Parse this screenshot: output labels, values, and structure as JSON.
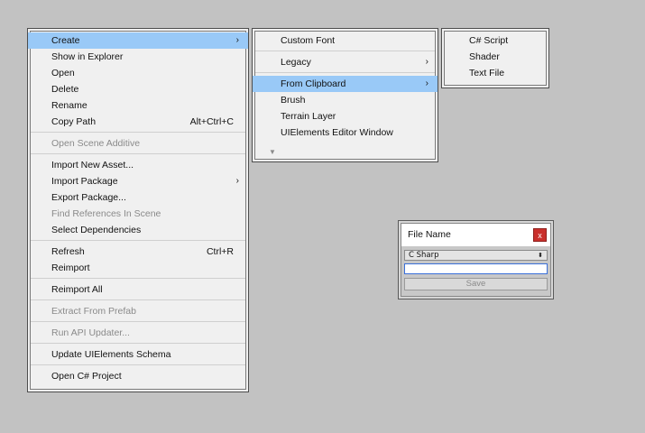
{
  "main_menu": {
    "items": [
      {
        "label": "Create",
        "arrow": "›"
      },
      {
        "label": "Show in Explorer"
      },
      {
        "label": "Open"
      },
      {
        "label": "Delete"
      },
      {
        "label": "Rename"
      },
      {
        "label": "Copy Path",
        "shortcut": "Alt+Ctrl+C"
      },
      {
        "label": "Open Scene Additive"
      },
      {
        "label": "Import New Asset..."
      },
      {
        "label": "Import Package",
        "arrow": "›"
      },
      {
        "label": "Export Package..."
      },
      {
        "label": "Find References In Scene"
      },
      {
        "label": "Select Dependencies"
      },
      {
        "label": "Refresh",
        "shortcut": "Ctrl+R"
      },
      {
        "label": "Reimport"
      },
      {
        "label": "Reimport All"
      },
      {
        "label": "Extract From Prefab"
      },
      {
        "label": "Run API Updater..."
      },
      {
        "label": "Update UIElements Schema"
      },
      {
        "label": "Open C# Project"
      }
    ]
  },
  "create_menu": {
    "items": [
      {
        "label": "Custom Font"
      },
      {
        "label": "Legacy",
        "arrow": "›"
      },
      {
        "label": "From Clipboard",
        "arrow": "›"
      },
      {
        "label": "Brush"
      },
      {
        "label": "Terrain Layer"
      },
      {
        "label": "UIElements Editor Window"
      }
    ],
    "scroll_indicator": "▼"
  },
  "clipboard_menu": {
    "items": [
      {
        "label": "C# Script"
      },
      {
        "label": "Shader"
      },
      {
        "label": "Text File"
      }
    ]
  },
  "dialog": {
    "title": "File Name",
    "close_glyph": "x",
    "type_select": "C Sharp",
    "select_caret": "⬍",
    "file_name_value": "",
    "save_label": "Save"
  },
  "colors": {
    "background": "#c2c2c2",
    "menu_bg": "#f0f0f0",
    "highlight": "#99c9f7",
    "disabled_text": "#8a8a8a",
    "close_button": "#c9302c"
  }
}
